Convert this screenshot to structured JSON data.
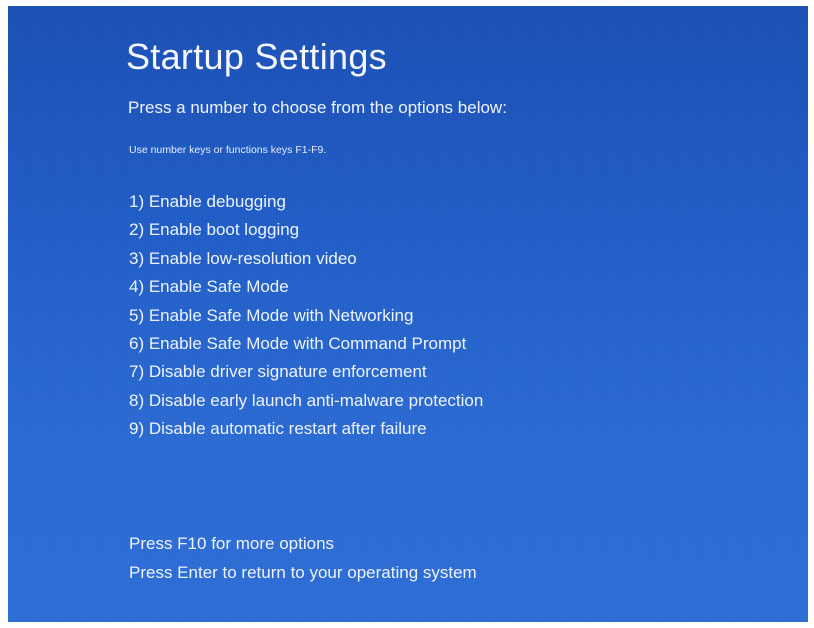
{
  "screen": {
    "title": "Startup Settings",
    "subtitle": "Press a number to choose from the options below:",
    "hint": "Use number keys or functions keys F1-F9."
  },
  "options": [
    {
      "label": "1) Enable debugging"
    },
    {
      "label": "2) Enable boot logging"
    },
    {
      "label": "3) Enable low-resolution video"
    },
    {
      "label": "4) Enable Safe Mode"
    },
    {
      "label": "5) Enable Safe Mode with Networking"
    },
    {
      "label": "6) Enable Safe Mode with Command Prompt"
    },
    {
      "label": "7) Disable driver signature enforcement"
    },
    {
      "label": "8) Disable early launch anti-malware protection"
    },
    {
      "label": "9) Disable automatic restart after failure"
    }
  ],
  "footer": {
    "more_options": "Press F10 for more options",
    "return": "Press Enter to return to your operating system"
  },
  "colors": {
    "background": "#1f5cc6",
    "text": "#eef3ff"
  }
}
